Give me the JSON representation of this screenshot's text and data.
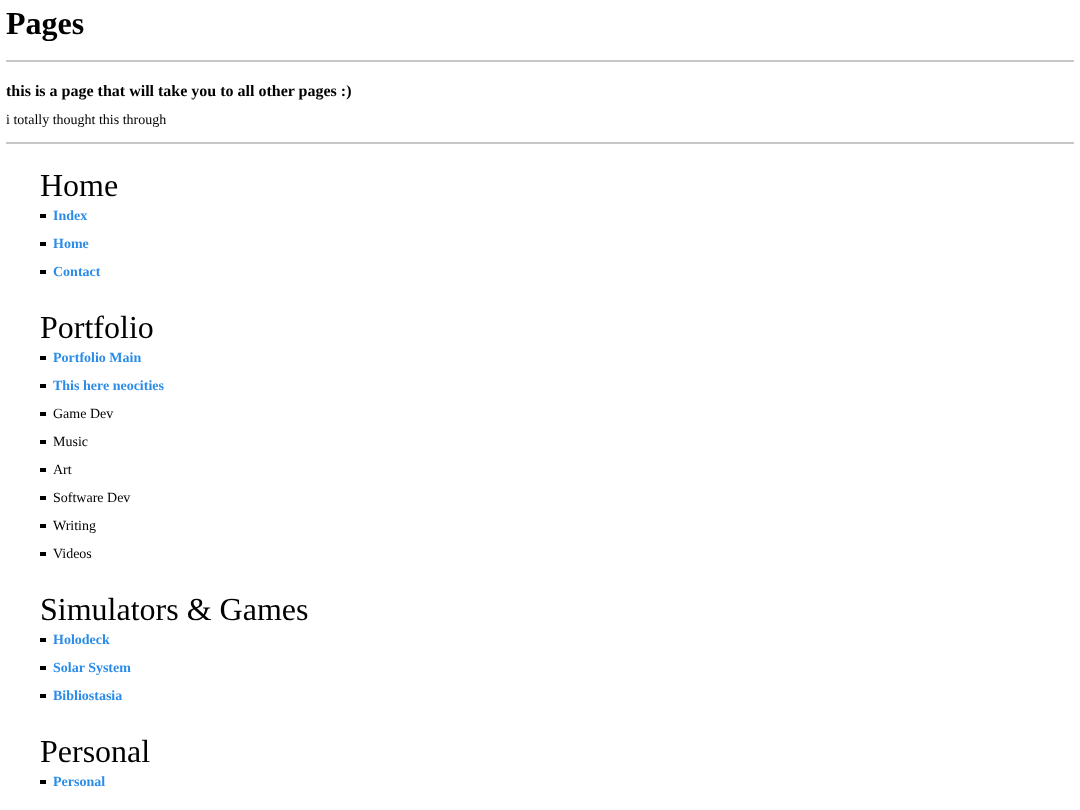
{
  "title": "Pages",
  "subtitle": "this is a page that will take you to all other pages :)",
  "note": "i totally thought this through",
  "sections": [
    {
      "heading": "Home",
      "items": [
        {
          "label": "Index",
          "kind": "link"
        },
        {
          "label": "Home",
          "kind": "link"
        },
        {
          "label": "Contact",
          "kind": "link"
        }
      ]
    },
    {
      "heading": "Portfolio",
      "items": [
        {
          "label": "Portfolio Main",
          "kind": "link"
        },
        {
          "label": "This here neocities",
          "kind": "link"
        },
        {
          "label": "Game Dev",
          "kind": "plain"
        },
        {
          "label": "Music",
          "kind": "plain"
        },
        {
          "label": "Art",
          "kind": "plain"
        },
        {
          "label": "Software Dev",
          "kind": "plain"
        },
        {
          "label": "Writing",
          "kind": "plain"
        },
        {
          "label": "Videos",
          "kind": "plain"
        }
      ]
    },
    {
      "heading": "Simulators & Games",
      "items": [
        {
          "label": "Holodeck",
          "kind": "link"
        },
        {
          "label": "Solar System",
          "kind": "link"
        },
        {
          "label": "Bibliostasia",
          "kind": "link"
        }
      ]
    },
    {
      "heading": "Personal",
      "items": [
        {
          "label": "Personal",
          "kind": "link"
        }
      ]
    }
  ]
}
